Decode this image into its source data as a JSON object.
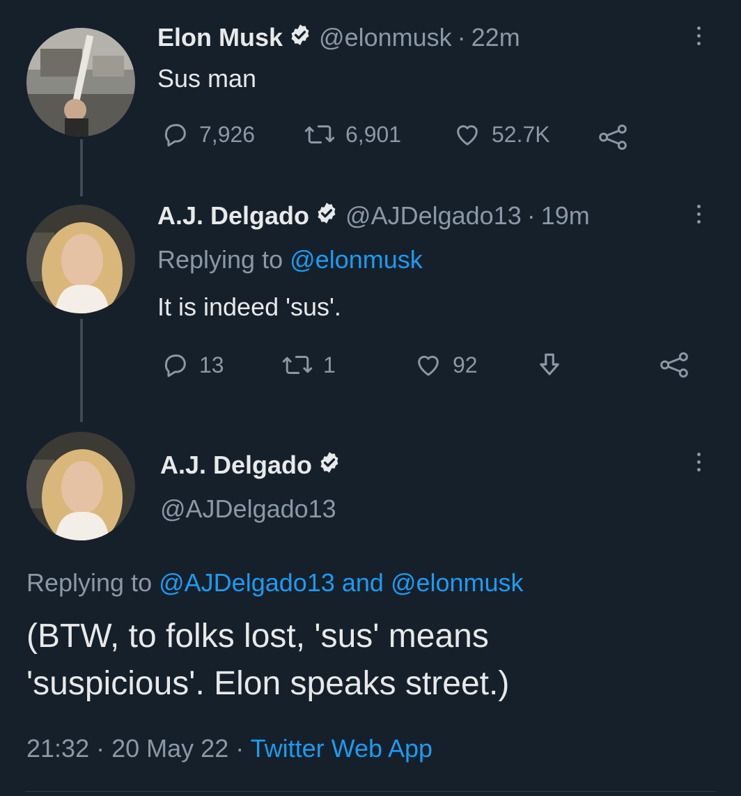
{
  "tweet1": {
    "name": "Elon Musk",
    "handle": "@elonmusk",
    "dot": "·",
    "time": "22m",
    "text": "Sus man",
    "replies": "7,926",
    "retweets": "6,901",
    "likes": "52.7K"
  },
  "tweet2": {
    "name": "A.J. Delgado",
    "handle": "@AJDelgado13",
    "dot": "·",
    "time": "19m",
    "replying_prefix": "Replying to",
    "replying_to": "@elonmusk",
    "text": "It is indeed 'sus'.",
    "replies": "13",
    "retweets": "1",
    "likes": "92"
  },
  "main": {
    "name": "A.J. Delgado",
    "handle": "@AJDelgado13",
    "replying_prefix": "Replying to",
    "replying_to_1": "@AJDelgado13",
    "replying_and": "and",
    "replying_to_2": "@elonmusk",
    "text_line1": "(BTW, to folks lost, 'sus' means",
    "text_line2": "'suspicious'. Elon speaks street.)",
    "time": "21:32",
    "dot1": "·",
    "date": "20 May 22",
    "dot2": "·",
    "source": "Twitter Web App"
  },
  "colors": {
    "background": "#16202b",
    "text": "#e7e9ea",
    "muted": "#8b98a5",
    "link": "#1d9bf0"
  },
  "icons": [
    "verified-badge-icon",
    "more-options-icon",
    "reply-icon",
    "retweet-icon",
    "like-icon",
    "share-icon",
    "download-icon"
  ]
}
